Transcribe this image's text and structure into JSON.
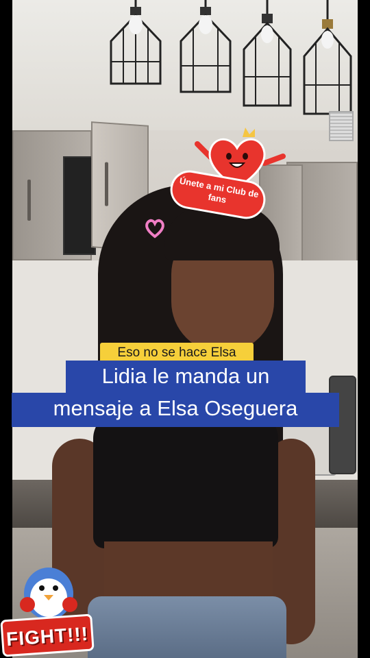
{
  "stickers": {
    "fan_club": "Únete a mi Club de fans",
    "fight": "FIGHT!!!"
  },
  "captions": {
    "yellow": "Eso no se hace Elsa",
    "blue_line1": "Lidia le manda un",
    "blue_line2": "mensaje a Elsa Oseguera"
  },
  "colors": {
    "caption_blue": "#2947a9",
    "caption_yellow": "#f6cf3a",
    "sticker_red": "#e8342d"
  }
}
